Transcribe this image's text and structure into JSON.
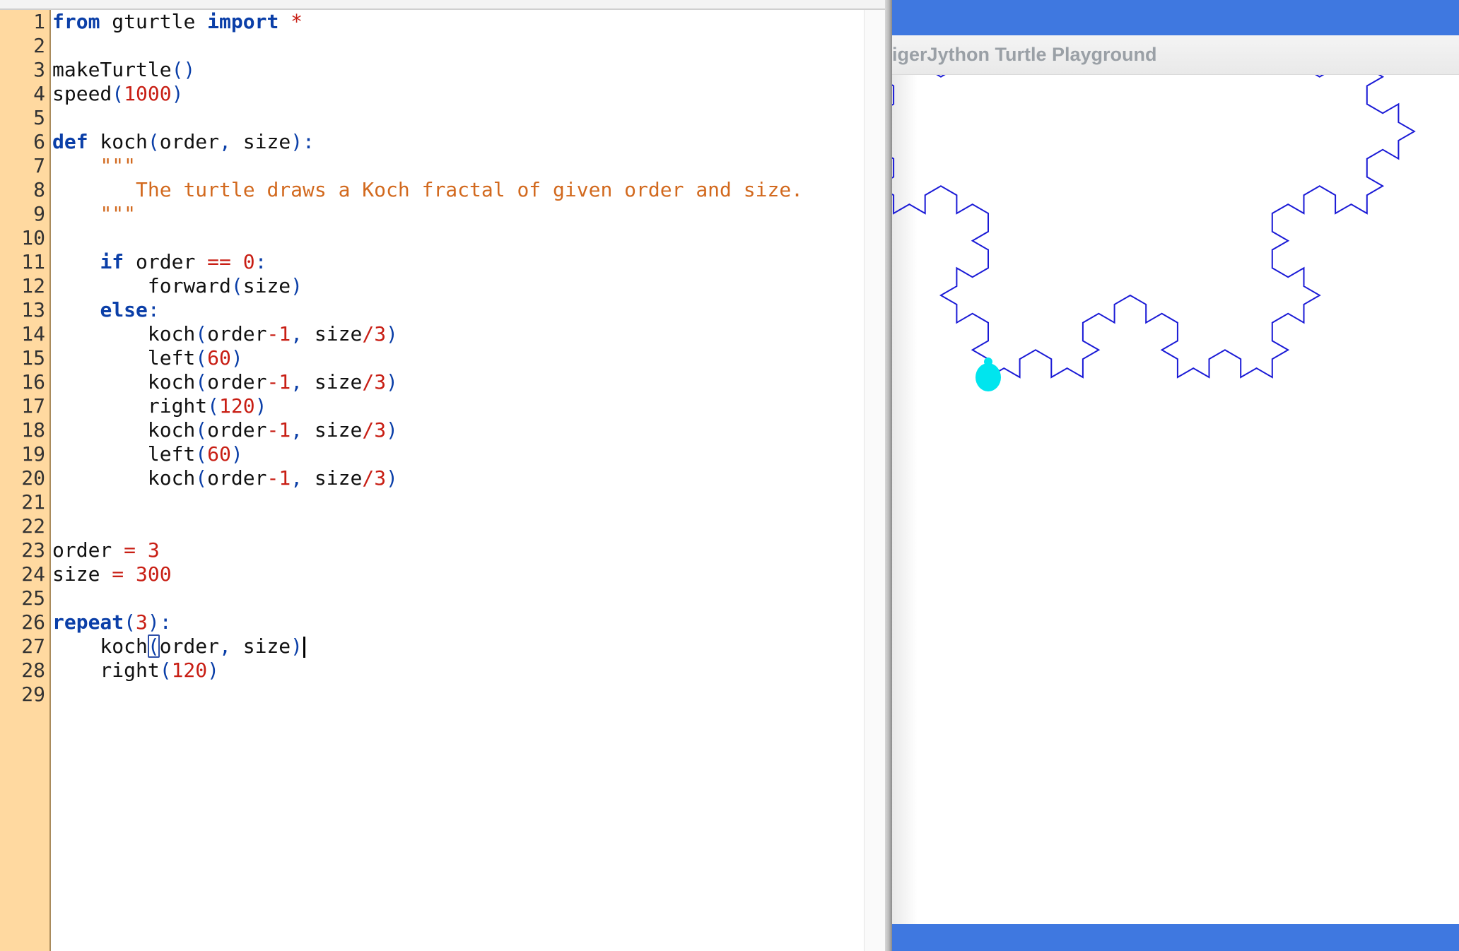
{
  "editor": {
    "lines": [
      {
        "n": "1",
        "tokens": [
          {
            "t": "from",
            "c": "kw"
          },
          {
            "t": " gturtle "
          },
          {
            "t": "import",
            "c": "kw"
          },
          {
            "t": " "
          },
          {
            "t": "*",
            "c": "op"
          }
        ]
      },
      {
        "n": "2",
        "tokens": []
      },
      {
        "n": "3",
        "tokens": [
          {
            "t": "makeTurtle"
          },
          {
            "t": "()",
            "c": "punc"
          }
        ]
      },
      {
        "n": "4",
        "tokens": [
          {
            "t": "speed"
          },
          {
            "t": "(",
            "c": "punc"
          },
          {
            "t": "1000",
            "c": "num"
          },
          {
            "t": ")",
            "c": "punc"
          }
        ]
      },
      {
        "n": "5",
        "tokens": []
      },
      {
        "n": "6",
        "tokens": [
          {
            "t": "def",
            "c": "kw"
          },
          {
            "t": " koch"
          },
          {
            "t": "(",
            "c": "punc"
          },
          {
            "t": "order"
          },
          {
            "t": ",",
            "c": "punc"
          },
          {
            "t": " size"
          },
          {
            "t": "):",
            "c": "punc"
          }
        ]
      },
      {
        "n": "7",
        "tokens": [
          {
            "t": "    "
          },
          {
            "t": "\"\"\"",
            "c": "str"
          }
        ]
      },
      {
        "n": "8",
        "tokens": [
          {
            "t": "       "
          },
          {
            "t": "The turtle draws a Koch fractal of given order and size.",
            "c": "str"
          }
        ]
      },
      {
        "n": "9",
        "tokens": [
          {
            "t": "    "
          },
          {
            "t": "\"\"\"",
            "c": "str"
          }
        ]
      },
      {
        "n": "10",
        "tokens": []
      },
      {
        "n": "11",
        "tokens": [
          {
            "t": "    "
          },
          {
            "t": "if",
            "c": "kw"
          },
          {
            "t": " order "
          },
          {
            "t": "==",
            "c": "op"
          },
          {
            "t": " "
          },
          {
            "t": "0",
            "c": "num"
          },
          {
            "t": ":",
            "c": "punc"
          }
        ]
      },
      {
        "n": "12",
        "tokens": [
          {
            "t": "        forward"
          },
          {
            "t": "(",
            "c": "punc"
          },
          {
            "t": "size"
          },
          {
            "t": ")",
            "c": "punc"
          }
        ]
      },
      {
        "n": "13",
        "tokens": [
          {
            "t": "    "
          },
          {
            "t": "else",
            "c": "kw"
          },
          {
            "t": ":",
            "c": "punc"
          }
        ]
      },
      {
        "n": "14",
        "tokens": [
          {
            "t": "        koch"
          },
          {
            "t": "(",
            "c": "punc"
          },
          {
            "t": "order"
          },
          {
            "t": "-",
            "c": "op"
          },
          {
            "t": "1",
            "c": "num"
          },
          {
            "t": ",",
            "c": "punc"
          },
          {
            "t": " size"
          },
          {
            "t": "/",
            "c": "op"
          },
          {
            "t": "3",
            "c": "num"
          },
          {
            "t": ")",
            "c": "punc"
          }
        ]
      },
      {
        "n": "15",
        "tokens": [
          {
            "t": "        left"
          },
          {
            "t": "(",
            "c": "punc"
          },
          {
            "t": "60",
            "c": "num"
          },
          {
            "t": ")",
            "c": "punc"
          }
        ]
      },
      {
        "n": "16",
        "tokens": [
          {
            "t": "        koch"
          },
          {
            "t": "(",
            "c": "punc"
          },
          {
            "t": "order"
          },
          {
            "t": "-",
            "c": "op"
          },
          {
            "t": "1",
            "c": "num"
          },
          {
            "t": ",",
            "c": "punc"
          },
          {
            "t": " size"
          },
          {
            "t": "/",
            "c": "op"
          },
          {
            "t": "3",
            "c": "num"
          },
          {
            "t": ")",
            "c": "punc"
          }
        ]
      },
      {
        "n": "17",
        "tokens": [
          {
            "t": "        right"
          },
          {
            "t": "(",
            "c": "punc"
          },
          {
            "t": "120",
            "c": "num"
          },
          {
            "t": ")",
            "c": "punc"
          }
        ]
      },
      {
        "n": "18",
        "tokens": [
          {
            "t": "        koch"
          },
          {
            "t": "(",
            "c": "punc"
          },
          {
            "t": "order"
          },
          {
            "t": "-",
            "c": "op"
          },
          {
            "t": "1",
            "c": "num"
          },
          {
            "t": ",",
            "c": "punc"
          },
          {
            "t": " size"
          },
          {
            "t": "/",
            "c": "op"
          },
          {
            "t": "3",
            "c": "num"
          },
          {
            "t": ")",
            "c": "punc"
          }
        ]
      },
      {
        "n": "19",
        "tokens": [
          {
            "t": "        left"
          },
          {
            "t": "(",
            "c": "punc"
          },
          {
            "t": "60",
            "c": "num"
          },
          {
            "t": ")",
            "c": "punc"
          }
        ]
      },
      {
        "n": "20",
        "tokens": [
          {
            "t": "        koch"
          },
          {
            "t": "(",
            "c": "punc"
          },
          {
            "t": "order"
          },
          {
            "t": "-",
            "c": "op"
          },
          {
            "t": "1",
            "c": "num"
          },
          {
            "t": ",",
            "c": "punc"
          },
          {
            "t": " size"
          },
          {
            "t": "/",
            "c": "op"
          },
          {
            "t": "3",
            "c": "num"
          },
          {
            "t": ")",
            "c": "punc"
          }
        ]
      },
      {
        "n": "21",
        "tokens": []
      },
      {
        "n": "22",
        "tokens": []
      },
      {
        "n": "23",
        "tokens": [
          {
            "t": "order "
          },
          {
            "t": "=",
            "c": "op"
          },
          {
            "t": " "
          },
          {
            "t": "3",
            "c": "num"
          }
        ]
      },
      {
        "n": "24",
        "tokens": [
          {
            "t": "size "
          },
          {
            "t": "=",
            "c": "op"
          },
          {
            "t": " "
          },
          {
            "t": "300",
            "c": "num"
          }
        ]
      },
      {
        "n": "25",
        "tokens": []
      },
      {
        "n": "26",
        "tokens": [
          {
            "t": "repeat",
            "c": "kw"
          },
          {
            "t": "(",
            "c": "punc"
          },
          {
            "t": "3",
            "c": "num"
          },
          {
            "t": "):",
            "c": "punc"
          }
        ]
      },
      {
        "n": "27",
        "tokens": [
          {
            "t": "    koch"
          },
          {
            "t": "(",
            "c": "bracket-hl"
          },
          {
            "t": "order"
          },
          {
            "t": ",",
            "c": "punc"
          },
          {
            "t": " size"
          },
          {
            "t": ")",
            "c": "punc"
          },
          {
            "t": "",
            "c": "caret"
          }
        ]
      },
      {
        "n": "28",
        "tokens": [
          {
            "t": "    right"
          },
          {
            "t": "(",
            "c": "punc"
          },
          {
            "t": "120",
            "c": "num"
          },
          {
            "t": ")",
            "c": "punc"
          }
        ]
      },
      {
        "n": "29",
        "tokens": []
      }
    ]
  },
  "playground": {
    "title": "igerJython Turtle Playground",
    "koch_order": 3,
    "koch_size": 300,
    "line_color": "#1a1ad6",
    "turtle_color": "#00e5ee"
  },
  "colors": {
    "gutter": "#ffd9a0",
    "keyword": "#0b3fa8",
    "number": "#c81e14",
    "docstring": "#d2691e",
    "window_bar": "#3f78e0"
  }
}
